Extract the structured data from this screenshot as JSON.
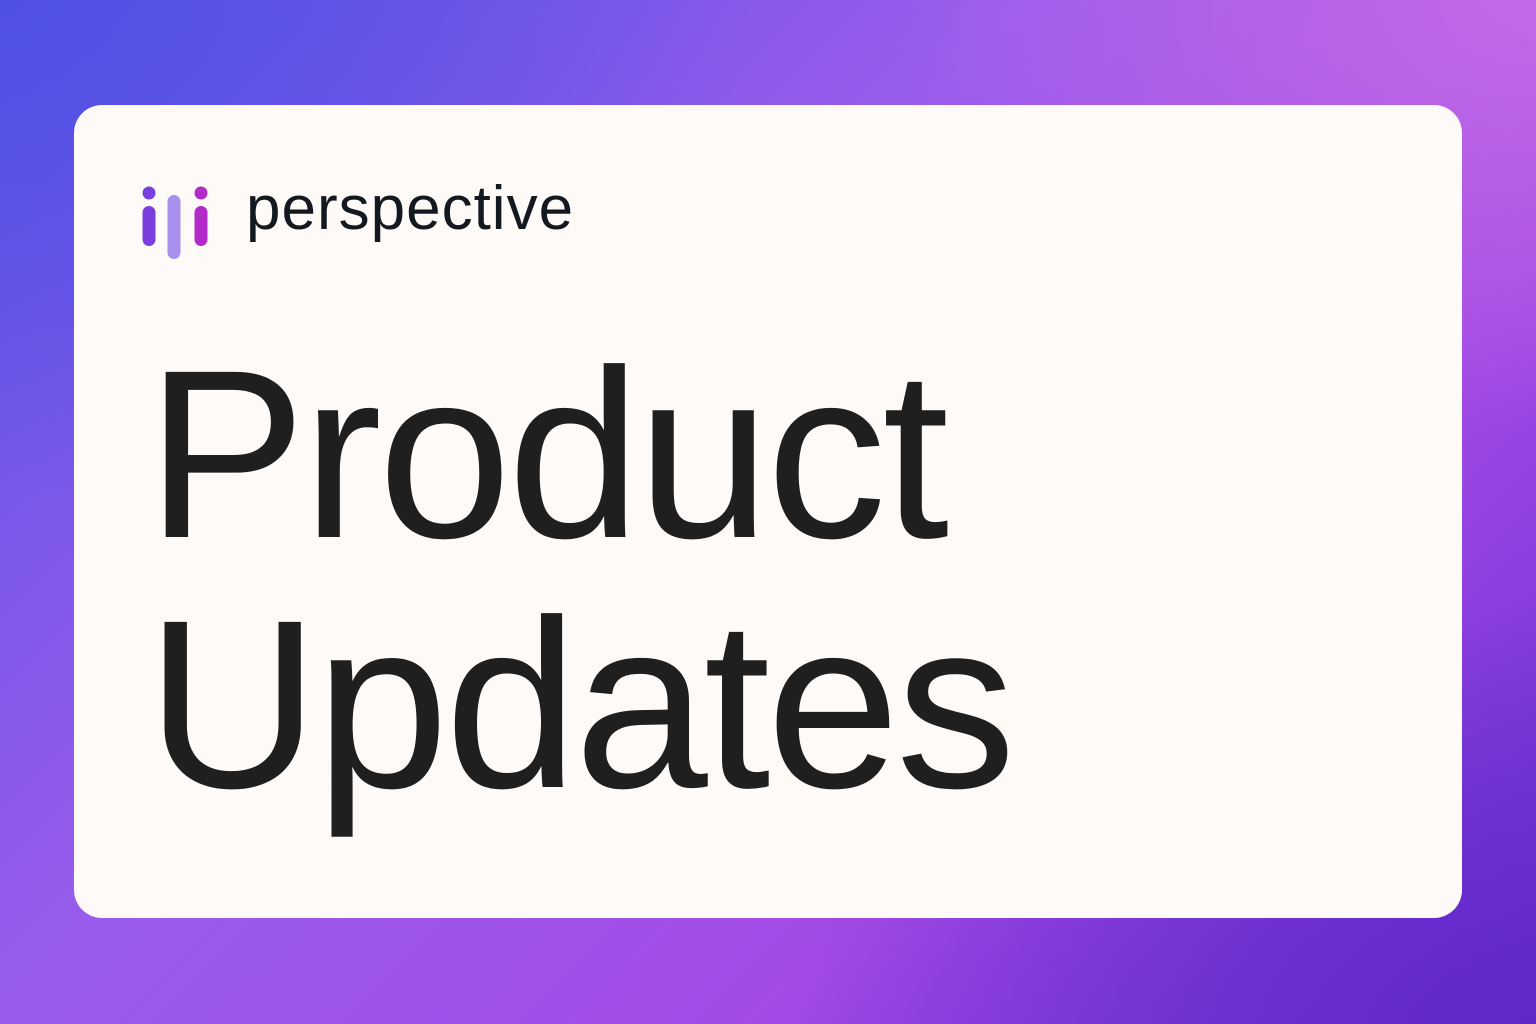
{
  "brand": {
    "name": "perspective",
    "icon": "perspective-logo-icon",
    "colors": {
      "bar_left": "#7b3fe0",
      "bar_middle": "#a990ec",
      "bar_right": "#b22bc9",
      "text": "#14181f"
    }
  },
  "headline": {
    "line1": "Product",
    "line2": "Updates"
  },
  "theme": {
    "card_background": "#fdfaf8",
    "text_color": "#1f1f1f",
    "gradient_colors": [
      "#5a55e6",
      "#9a5cec",
      "#c86ee6",
      "#6a2ed4"
    ]
  }
}
